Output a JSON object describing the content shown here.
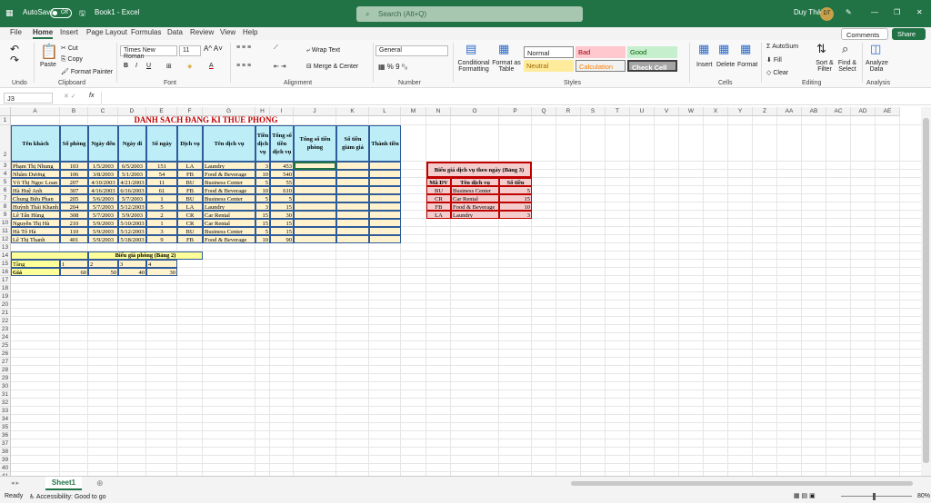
{
  "titlebar": {
    "autosave_label": "AutoSave",
    "autosave_state": "Off",
    "filename": "Book1 - Excel",
    "search_placeholder": "Search (Alt+Q)",
    "user_name": "Duy Thái",
    "user_initials": "DT"
  },
  "tabs": [
    "File",
    "Home",
    "Insert",
    "Page Layout",
    "Formulas",
    "Data",
    "Review",
    "View",
    "Help"
  ],
  "active_tab": "Home",
  "comments_label": "Comments",
  "share_label": "Share",
  "ribbon": {
    "groups": [
      "Undo",
      "Clipboard",
      "Font",
      "Alignment",
      "Number",
      "Styles",
      "Cells",
      "Editing",
      "Analysis"
    ],
    "clipboard": {
      "paste": "Paste",
      "cut": "Cut",
      "copy": "Copy",
      "painter": "Format Painter"
    },
    "font": {
      "name": "Times New Roman",
      "size": "11"
    },
    "alignment": {
      "wrap": "Wrap Text",
      "merge": "Merge & Center"
    },
    "number": {
      "format": "General"
    },
    "styles": {
      "conditional": "Conditional Formatting",
      "format_table": "Format as Table",
      "normal": "Normal",
      "bad": "Bad",
      "good": "Good",
      "neutral": "Neutral",
      "calculation": "Calculation",
      "check": "Check Cell"
    },
    "cells": {
      "insert": "Insert",
      "delete": "Delete",
      "format": "Format"
    },
    "editing": {
      "autosum": "AutoSum",
      "fill": "Fill",
      "clear": "Clear",
      "sort": "Sort & Filter",
      "find": "Find & Select"
    },
    "analysis": {
      "analyze": "Analyze Data"
    }
  },
  "formula_bar": {
    "name_box": "J3",
    "fx": "fx",
    "value": ""
  },
  "columns": [
    "A",
    "B",
    "C",
    "D",
    "E",
    "F",
    "G",
    "H",
    "I",
    "J",
    "K",
    "L",
    "M",
    "N",
    "O",
    "P",
    "Q",
    "R",
    "S",
    "T",
    "U",
    "V",
    "W",
    "X",
    "Y",
    "Z",
    "AA",
    "AB",
    "AC",
    "AD",
    "AE"
  ],
  "main_table": {
    "title": "DANH SÁCH ĐĂNG KÍ THUÊ PHÒNG",
    "headers": [
      "Tên khách",
      "Số phòng",
      "Ngày đến",
      "Ngày đi",
      "Số ngày",
      "Dịch vụ",
      "Tên dịch vụ",
      "Tiền dịch vụ",
      "Tổng số tiền dịch vụ",
      "Tổng số tiền phòng",
      "Số tiền giảm giá",
      "Thành tiền"
    ],
    "rows": [
      [
        "Phạm Thị Nhung",
        "103",
        "1/5/2003",
        "6/5/2003",
        "151",
        "LA",
        "Laundry",
        "3",
        "453",
        "",
        "",
        ""
      ],
      [
        "Nhâm Dương",
        "106",
        "3/8/2003",
        "5/1/2003",
        "54",
        "FB",
        "Food & Beverage",
        "10",
        "540",
        "",
        "",
        ""
      ],
      [
        "Võ Thị Ngọc Loan",
        "207",
        "4/10/2003",
        "4/21/2003",
        "11",
        "BU",
        "Business Center",
        "5",
        "55",
        "",
        "",
        ""
      ],
      [
        "Hà Huệ Anh",
        "307",
        "4/16/2003",
        "6/16/2003",
        "61",
        "FB",
        "Food & Beverage",
        "10",
        "610",
        "",
        "",
        ""
      ],
      [
        "Chung Bửu Phan",
        "205",
        "5/6/2003",
        "5/7/2003",
        "1",
        "BU",
        "Business Center",
        "5",
        "5",
        "",
        "",
        ""
      ],
      [
        "Huỳnh Thái Khanh",
        "204",
        "5/7/2003",
        "5/12/2003",
        "5",
        "LA",
        "Laundry",
        "3",
        "15",
        "",
        "",
        ""
      ],
      [
        "Lê Tấn Hùng",
        "308",
        "5/7/2003",
        "5/9/2003",
        "2",
        "CR",
        "Car Rental",
        "15",
        "30",
        "",
        "",
        ""
      ],
      [
        "Nguyễn Thị Hà",
        "210",
        "5/9/2003",
        "5/10/2003",
        "1",
        "CR",
        "Car Rental",
        "15",
        "15",
        "",
        "",
        ""
      ],
      [
        "Hà Tô Hà",
        "110",
        "5/9/2003",
        "5/12/2003",
        "3",
        "BU",
        "Business Center",
        "5",
        "15",
        "",
        "",
        ""
      ],
      [
        "Lê Thị Thanh",
        "401",
        "5/9/2003",
        "5/18/2003",
        "9",
        "FB",
        "Food & Beverage",
        "10",
        "90",
        "",
        "",
        ""
      ]
    ]
  },
  "price_table": {
    "title": "Biểu giá phòng (Bảng 2)",
    "row_labels": [
      "Tầng",
      "Giá"
    ],
    "floors": [
      "1",
      "2",
      "3",
      "4"
    ],
    "prices": [
      "60",
      "50",
      "40",
      "30"
    ]
  },
  "service_table": {
    "title": "Biểu giá dịch vụ theo ngày (Bảng 3)",
    "headers": [
      "Mã DV",
      "Tên dịch vụ",
      "Số tiền"
    ],
    "rows": [
      [
        "BU",
        "Business Center",
        "5"
      ],
      [
        "CR",
        "Car Rental",
        "15"
      ],
      [
        "FB",
        "Food & Beverage",
        "10"
      ],
      [
        "LA",
        "Laundry",
        "3"
      ]
    ]
  },
  "sheet_tab": "Sheet1",
  "status": {
    "ready": "Ready",
    "accessibility": "Accessibility: Good to go",
    "zoom": "80%"
  },
  "colors": {
    "accent": "#217346",
    "table_header": "#bdeef8",
    "table_body": "#fff2cc",
    "table_border": "#2e5b9a",
    "service_border": "#c00000",
    "service_header": "#f4cccc",
    "title_red": "#c00000"
  }
}
